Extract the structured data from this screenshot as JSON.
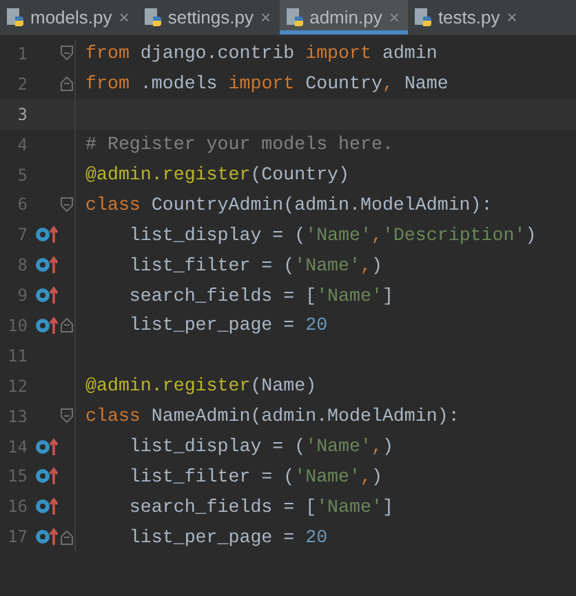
{
  "tabs": [
    {
      "label": "models.py",
      "close": "×",
      "selected": false
    },
    {
      "label": "settings.py",
      "close": "×",
      "selected": false
    },
    {
      "label": "admin.py",
      "close": "×",
      "selected": true
    },
    {
      "label": "tests.py",
      "close": "×",
      "selected": false
    }
  ],
  "editor": {
    "lines": [
      {
        "number": "1",
        "current": false,
        "override": false,
        "fold_start": true,
        "fold_end": false,
        "tokens": [
          {
            "kind": "keyword",
            "text": "from"
          },
          {
            "kind": "plain",
            "text": " django.contrib "
          },
          {
            "kind": "keyword",
            "text": "import"
          },
          {
            "kind": "plain",
            "text": " admin"
          }
        ]
      },
      {
        "number": "2",
        "current": false,
        "override": false,
        "fold_start": false,
        "fold_end": true,
        "tokens": [
          {
            "kind": "keyword",
            "text": "from"
          },
          {
            "kind": "plain",
            "text": " .models "
          },
          {
            "kind": "keyword",
            "text": "import"
          },
          {
            "kind": "plain",
            "text": " Country"
          },
          {
            "kind": "keyword",
            "text": ","
          },
          {
            "kind": "plain",
            "text": " Name"
          }
        ]
      },
      {
        "number": "3",
        "current": true,
        "override": false,
        "fold_start": false,
        "fold_end": false
      },
      {
        "number": "4",
        "current": false,
        "override": false,
        "fold_start": false,
        "fold_end": false,
        "tokens": [
          {
            "kind": "comment",
            "text": "# Register your models here."
          }
        ]
      },
      {
        "number": "5",
        "current": false,
        "override": false,
        "fold_start": false,
        "fold_end": false,
        "tokens": [
          {
            "kind": "decorator",
            "text": "@admin.register"
          },
          {
            "kind": "plain",
            "text": "(Country)"
          }
        ]
      },
      {
        "number": "6",
        "current": false,
        "override": false,
        "fold_start": true,
        "fold_end": false,
        "tokens": [
          {
            "kind": "keyword",
            "text": "class"
          },
          {
            "kind": "plain",
            "text": " CountryAdmin(admin.ModelAdmin):"
          }
        ]
      },
      {
        "number": "7",
        "current": false,
        "override": true,
        "fold_start": false,
        "fold_end": false,
        "tokens": [
          {
            "kind": "plain",
            "text": "    list_display = ("
          },
          {
            "kind": "string",
            "text": "'Name'"
          },
          {
            "kind": "keyword",
            "text": ","
          },
          {
            "kind": "string",
            "text": "'Description'"
          },
          {
            "kind": "plain",
            "text": ")"
          }
        ]
      },
      {
        "number": "8",
        "current": false,
        "override": true,
        "fold_start": false,
        "fold_end": false,
        "tokens": [
          {
            "kind": "plain",
            "text": "    list_filter = ("
          },
          {
            "kind": "string",
            "text": "'Name'"
          },
          {
            "kind": "keyword",
            "text": ","
          },
          {
            "kind": "plain",
            "text": ")"
          }
        ]
      },
      {
        "number": "9",
        "current": false,
        "override": true,
        "fold_start": false,
        "fold_end": false,
        "tokens": [
          {
            "kind": "plain",
            "text": "    search_fields = ["
          },
          {
            "kind": "string",
            "text": "'Name'"
          },
          {
            "kind": "plain",
            "text": "]"
          }
        ]
      },
      {
        "number": "10",
        "current": false,
        "override": true,
        "fold_start": false,
        "fold_end": true,
        "tokens": [
          {
            "kind": "plain",
            "text": "    list_per_page = "
          },
          {
            "kind": "number",
            "text": "20"
          }
        ]
      },
      {
        "number": "11",
        "current": false,
        "override": false,
        "fold_start": false,
        "fold_end": false
      },
      {
        "number": "12",
        "current": false,
        "override": false,
        "fold_start": false,
        "fold_end": false,
        "tokens": [
          {
            "kind": "decorator",
            "text": "@admin.register"
          },
          {
            "kind": "plain",
            "text": "(Name)"
          }
        ]
      },
      {
        "number": "13",
        "current": false,
        "override": false,
        "fold_start": true,
        "fold_end": false,
        "tokens": [
          {
            "kind": "keyword",
            "text": "class"
          },
          {
            "kind": "plain",
            "text": " NameAdmin(admin.ModelAdmin):"
          }
        ]
      },
      {
        "number": "14",
        "current": false,
        "override": true,
        "fold_start": false,
        "fold_end": false,
        "tokens": [
          {
            "kind": "plain",
            "text": "    list_display = ("
          },
          {
            "kind": "string",
            "text": "'Name'"
          },
          {
            "kind": "keyword",
            "text": ","
          },
          {
            "kind": "plain",
            "text": ")"
          }
        ]
      },
      {
        "number": "15",
        "current": false,
        "override": true,
        "fold_start": false,
        "fold_end": false,
        "tokens": [
          {
            "kind": "plain",
            "text": "    list_filter = ("
          },
          {
            "kind": "string",
            "text": "'Name'"
          },
          {
            "kind": "keyword",
            "text": ","
          },
          {
            "kind": "plain",
            "text": ")"
          }
        ]
      },
      {
        "number": "16",
        "current": false,
        "override": true,
        "fold_start": false,
        "fold_end": false,
        "tokens": [
          {
            "kind": "plain",
            "text": "    search_fields = ["
          },
          {
            "kind": "string",
            "text": "'Name'"
          },
          {
            "kind": "plain",
            "text": "]"
          }
        ]
      },
      {
        "number": "17",
        "current": false,
        "override": true,
        "fold_start": false,
        "fold_end": true,
        "tokens": [
          {
            "kind": "plain",
            "text": "    list_per_page = "
          },
          {
            "kind": "number",
            "text": "20"
          }
        ]
      }
    ]
  }
}
